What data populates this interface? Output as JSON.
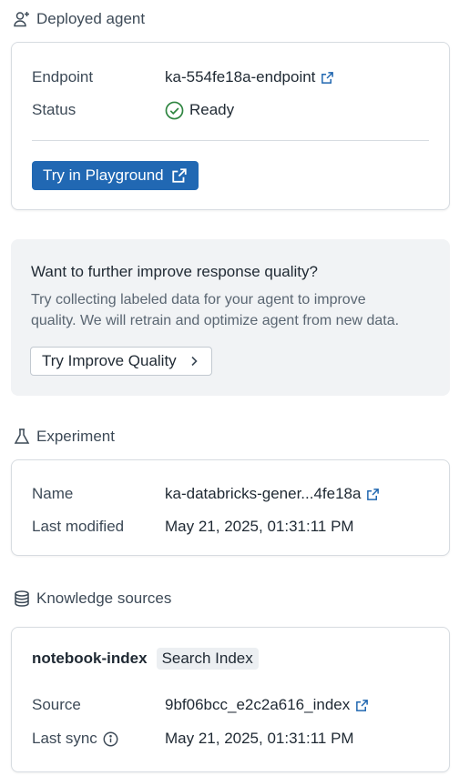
{
  "deployed": {
    "header": "Deployed agent",
    "endpoint_label": "Endpoint",
    "endpoint_value": "ka-554fe18a-endpoint",
    "status_label": "Status",
    "status_value": "Ready",
    "playground_button": "Try in Playground"
  },
  "improve": {
    "title": "Want to further improve response quality?",
    "description_line1": "Try collecting labeled data for your agent to improve",
    "description_line2": "quality. We will retrain and optimize agent from new data.",
    "button": "Try Improve Quality"
  },
  "experiment": {
    "header": "Experiment",
    "name_label": "Name",
    "name_value": "ka-databricks-gener...4fe18a",
    "modified_label": "Last modified",
    "modified_value": "May 21, 2025, 01:31:11 PM"
  },
  "knowledge": {
    "header": "Knowledge sources",
    "source_name": "notebook-index",
    "source_tag": "Search Index",
    "source_label": "Source",
    "source_value": "9bf06bcc_e2c2a616_index",
    "sync_label": "Last sync",
    "sync_value": "May 21, 2025, 01:31:11 PM"
  },
  "colors": {
    "link": "#2067b0",
    "primary": "#2168b3",
    "success": "#2e8540"
  }
}
